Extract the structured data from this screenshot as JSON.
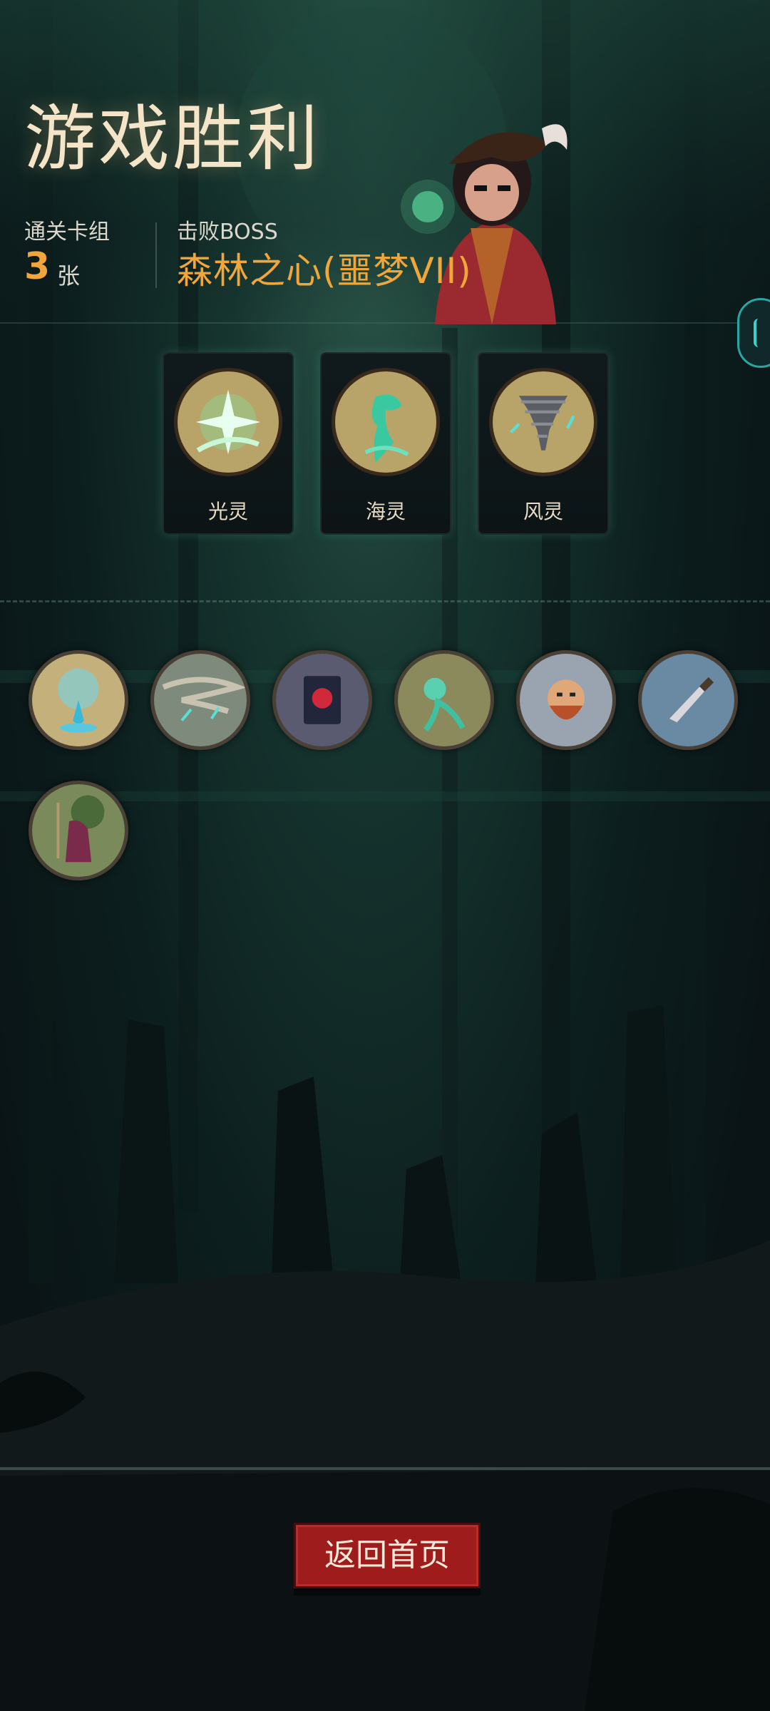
{
  "header": {
    "title": "游戏胜利",
    "deck_label": "通关卡组",
    "deck_count": "3",
    "deck_unit": "张",
    "boss_label": "击败BOSS",
    "boss_name": "森林之心(噩梦VII)"
  },
  "cards": [
    {
      "name": "光灵",
      "icon": "light-spirit-icon"
    },
    {
      "name": "海灵",
      "icon": "sea-spirit-icon"
    },
    {
      "name": "风灵",
      "icon": "wind-spirit-icon"
    }
  ],
  "relics": [
    "water-fountain-relic-icon",
    "tornado-relic-icon",
    "red-book-relic-icon",
    "tentacle-relic-icon",
    "bearded-man-relic-icon",
    "dagger-relic-icon",
    "hooded-figure-relic-icon"
  ],
  "actions": {
    "home_label": "返回首页"
  },
  "colors": {
    "accent": "#f0a63a",
    "button": "#9e1c1c",
    "medal_bg": "#b8a468"
  }
}
